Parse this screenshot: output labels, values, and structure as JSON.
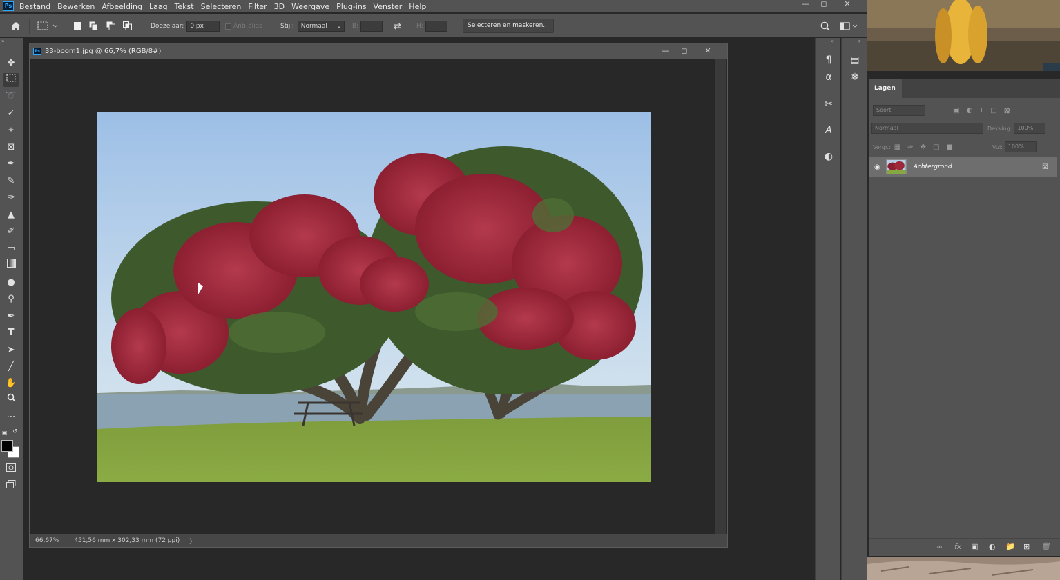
{
  "app": {
    "logo": "Ps"
  },
  "menu": [
    "Bestand",
    "Bewerken",
    "Afbeelding",
    "Laag",
    "Tekst",
    "Selecteren",
    "Filter",
    "3D",
    "Weergave",
    "Plug-ins",
    "Venster",
    "Help"
  ],
  "options": {
    "feather_label": "Doezelaar:",
    "feather_value": "0 px",
    "antialias_label": "Anti-alias",
    "style_label": "Stijl:",
    "style_value": "Normaal",
    "width_label": "B:",
    "height_label": "H:",
    "select_mask_label": "Selecteren en maskeren..."
  },
  "document": {
    "title": "33-boom1.jpg @ 66,7% (RGB/8#)",
    "zoom": "66,67%",
    "size_info": "451,56 mm x 302,33 mm (72 ppi)",
    "status_arrow": "〉"
  },
  "layers_panel": {
    "tab": "Lagen",
    "filter_placeholder": "Soort",
    "blend_mode": "Normaal",
    "opacity_label": "Dekking:",
    "opacity_value": "100%",
    "lock_label": "Vergr.:",
    "fill_label": "Vul:",
    "fill_value": "100%",
    "layers": [
      {
        "name": "Achtergrond",
        "visible": true,
        "locked": true
      }
    ]
  },
  "colors": {
    "foreground": "#000000",
    "background": "#ffffff",
    "accent": "#31a8ff"
  }
}
